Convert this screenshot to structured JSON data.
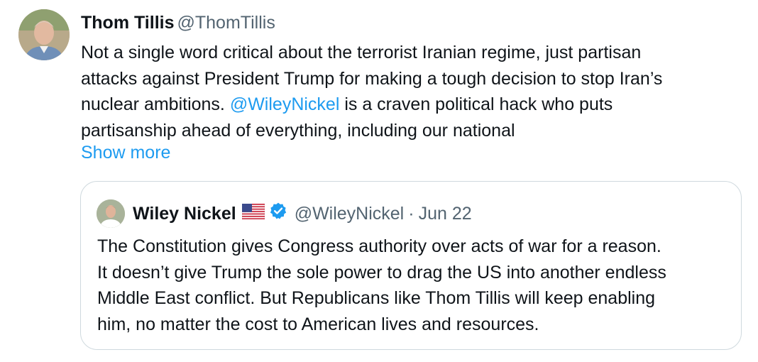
{
  "tweet": {
    "author": {
      "display_name": "Thom Tillis",
      "handle": "@ThomTillis",
      "avatar_icon": "person-avatar"
    },
    "body_lines": [
      {
        "text": "Not a single word critical about the terrorist Iranian regime, just partisan"
      },
      {
        "text": "attacks against President Trump for making a tough decision to stop Iran’s"
      },
      {
        "before": "nuclear ambitions. ",
        "mention": "@WileyNickel",
        "after": " is a craven political hack who puts"
      },
      {
        "text": "partisanship ahead of everything, including our national"
      }
    ],
    "show_more_label": "Show more"
  },
  "quote": {
    "author": {
      "display_name": "Wiley Nickel",
      "handle": "@WileyNickel",
      "separator": "·",
      "date": "Jun 22",
      "flag_icon": "us-flag-icon",
      "verified_icon": "verified-badge-icon"
    },
    "text_lines": [
      "The Constitution gives Congress authority over acts of war for a reason.",
      "It doesn’t give Trump the sole power to drag the US into another endless",
      "Middle East conflict. But Republicans like Thom Tillis will keep enabling",
      "him, no matter the cost to American lives and resources."
    ]
  },
  "colors": {
    "text": "#0f1419",
    "secondary": "#536471",
    "link": "#1d9bf0",
    "border": "#cfd9de",
    "verified": "#1d9bf0"
  }
}
